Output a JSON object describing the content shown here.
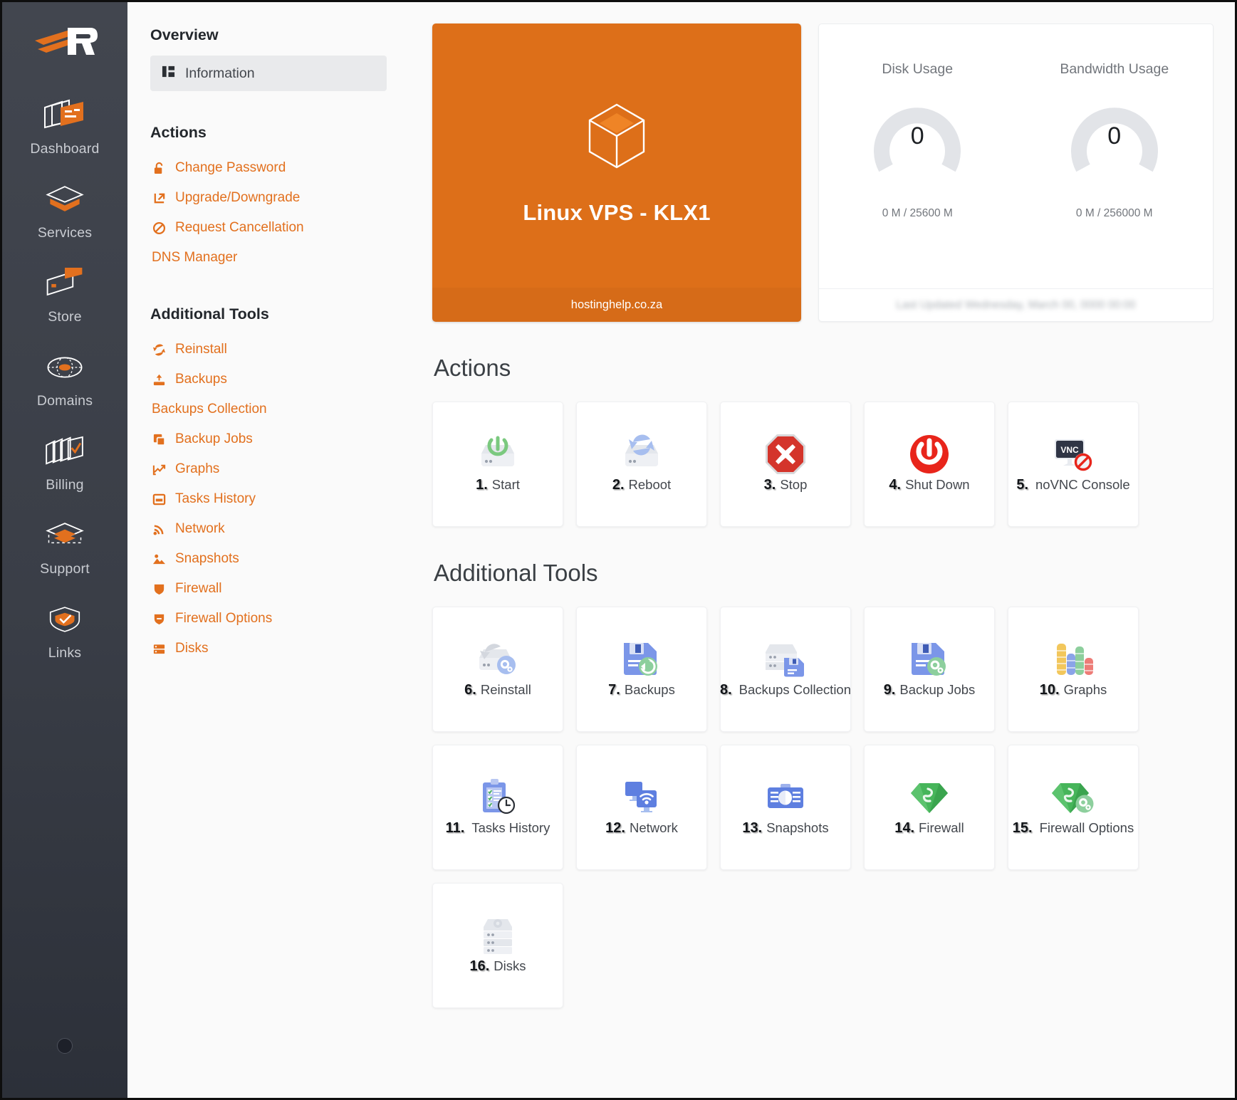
{
  "rail": {
    "logo_name": "brand-logo",
    "items": [
      {
        "label": "Dashboard",
        "icon": "dashboard-icon"
      },
      {
        "label": "Services",
        "icon": "services-icon"
      },
      {
        "label": "Store",
        "icon": "store-icon"
      },
      {
        "label": "Domains",
        "icon": "domains-icon"
      },
      {
        "label": "Billing",
        "icon": "billing-icon"
      },
      {
        "label": "Support",
        "icon": "support-icon"
      },
      {
        "label": "Links",
        "icon": "links-icon"
      }
    ]
  },
  "secnav": {
    "overview_heading": "Overview",
    "information_label": "Information",
    "actions_heading": "Actions",
    "actions": [
      {
        "label": "Change Password",
        "icon": "unlock-icon"
      },
      {
        "label": "Upgrade/Downgrade",
        "icon": "upgrade-arrow-icon"
      },
      {
        "label": "Request Cancellation",
        "icon": "ban-icon"
      },
      {
        "label": "DNS Manager",
        "icon": "none"
      }
    ],
    "tools_heading": "Additional Tools",
    "tools": [
      {
        "label": "Reinstall",
        "icon": "sync-icon"
      },
      {
        "label": "Backups",
        "icon": "backup-upload-icon"
      },
      {
        "label": "Backups Collection",
        "icon": "none"
      },
      {
        "label": "Backup Jobs",
        "icon": "copy-icon"
      },
      {
        "label": "Graphs",
        "icon": "chart-line-icon"
      },
      {
        "label": "Tasks History",
        "icon": "window-icon"
      },
      {
        "label": "Network",
        "icon": "signal-icon"
      },
      {
        "label": "Snapshots",
        "icon": "image-icon"
      },
      {
        "label": "Firewall",
        "icon": "shield-icon"
      },
      {
        "label": "Firewall Options",
        "icon": "shield-options-icon"
      },
      {
        "label": "Disks",
        "icon": "server-icon"
      }
    ]
  },
  "vps_card": {
    "title": "Linux VPS - KLX1",
    "footer": "hostinghelp.co.za",
    "icon": "cube-icon",
    "color": "#dd6f19"
  },
  "usage": {
    "disk": {
      "title": "Disk Usage",
      "value": "0",
      "sub": "0 M / 25600 M",
      "percent": 0
    },
    "bandwidth": {
      "title": "Bandwidth Usage",
      "value": "0",
      "sub": "0 M / 256000 M",
      "percent": 0
    },
    "last_updated": "Last Updated Wednesday, March 00, 0000 00:00"
  },
  "actions_section": {
    "heading": "Actions",
    "tiles": [
      {
        "num": "1.",
        "label": "Start",
        "icon": "server-power-on-icon"
      },
      {
        "num": "2.",
        "label": "Reboot",
        "icon": "server-reboot-icon"
      },
      {
        "num": "3.",
        "label": "Stop",
        "icon": "stop-octagon-icon"
      },
      {
        "num": "4.",
        "label": "Shut Down",
        "icon": "power-off-icon"
      },
      {
        "num": "5.",
        "label": "noVNC Console",
        "icon": "vnc-disabled-icon"
      }
    ]
  },
  "tools_section": {
    "heading": "Additional Tools",
    "tiles": [
      {
        "num": "6.",
        "label": "Reinstall",
        "icon": "server-reinstall-icon"
      },
      {
        "num": "7.",
        "label": "Backups",
        "icon": "floppy-restore-icon"
      },
      {
        "num": "8.",
        "label": "Backups Collection",
        "icon": "server-floppy-icon"
      },
      {
        "num": "9.",
        "label": "Backup Jobs",
        "icon": "floppy-gear-icon"
      },
      {
        "num": "10.",
        "label": "Graphs",
        "icon": "bar-chart-icon"
      },
      {
        "num": "11.",
        "label": "Tasks History",
        "icon": "clipboard-clock-icon"
      },
      {
        "num": "12.",
        "label": "Network",
        "icon": "network-wifi-icon"
      },
      {
        "num": "13.",
        "label": "Snapshots",
        "icon": "camera-icon"
      },
      {
        "num": "14.",
        "label": "Firewall",
        "icon": "firewall-gem-icon"
      },
      {
        "num": "15.",
        "label": "Firewall Options",
        "icon": "firewall-gem-gear-icon"
      },
      {
        "num": "16.",
        "label": "Disks",
        "icon": "disk-stack-icon"
      }
    ]
  }
}
